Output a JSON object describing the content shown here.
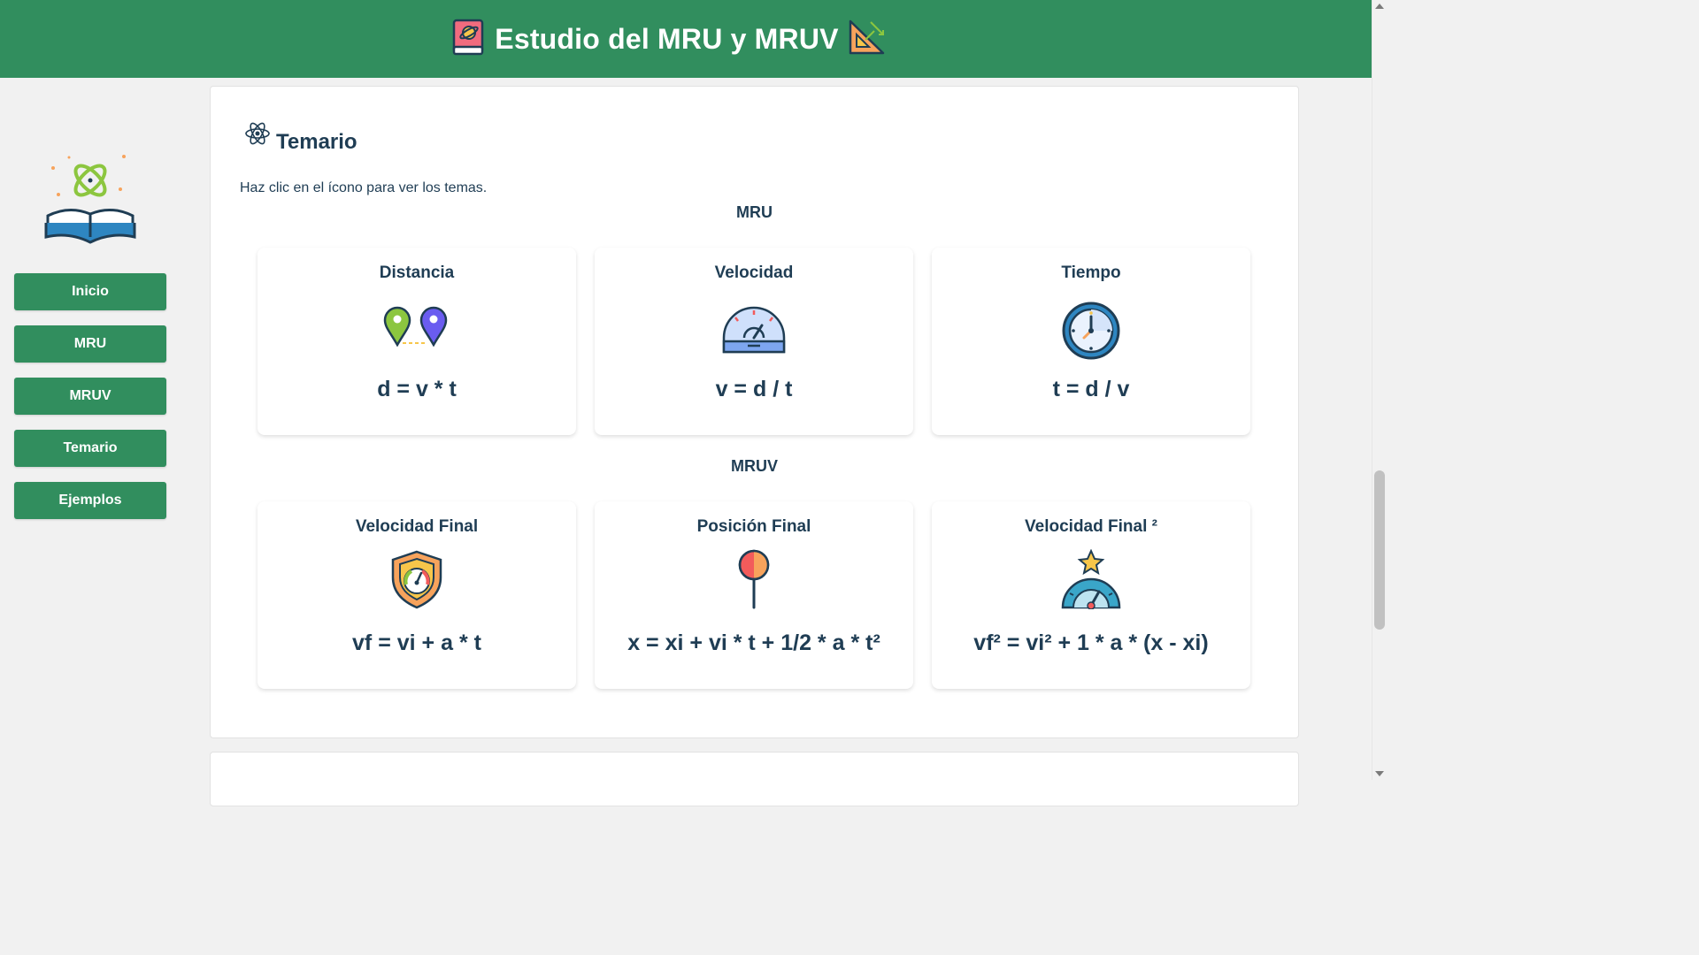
{
  "header": {
    "title": "Estudio del MRU y MRUV",
    "left_icon": "book-icon",
    "right_icon": "triangle-ruler-icon"
  },
  "colors": {
    "primary": "#318e5e",
    "text": "#1f3d54",
    "background": "#f1f1f1"
  },
  "sidebar": {
    "logo": "atom-book-icon",
    "items": [
      {
        "label": "Inicio"
      },
      {
        "label": "MRU"
      },
      {
        "label": "MRUV"
      },
      {
        "label": "Temario"
      },
      {
        "label": "Ejemplos"
      }
    ]
  },
  "temario": {
    "icon": "atom-icon",
    "title": "Temario",
    "hint": "Haz clic en el ícono para ver los temas.",
    "groups": [
      {
        "label": "MRU",
        "cards": [
          {
            "name": "Distancia",
            "icon": "map-pins-icon",
            "formula": "d = v * t"
          },
          {
            "name": "Velocidad",
            "icon": "speedometer-icon",
            "formula": "v = d / t"
          },
          {
            "name": "Tiempo",
            "icon": "clock-icon",
            "formula": "t = d / v"
          }
        ]
      },
      {
        "label": "MRUV",
        "cards": [
          {
            "name": "Velocidad Final",
            "icon": "shield-gauge-icon",
            "formula": "vf = vi + a * t"
          },
          {
            "name": "Posición Final",
            "icon": "pin-icon",
            "formula": "x = xi + vi * t + 1/2 * a * t²"
          },
          {
            "name": "Velocidad Final ²",
            "icon": "star-gauge-icon",
            "formula": "vf² = vi² + 1 * a * (x - xi)"
          }
        ]
      }
    ]
  }
}
